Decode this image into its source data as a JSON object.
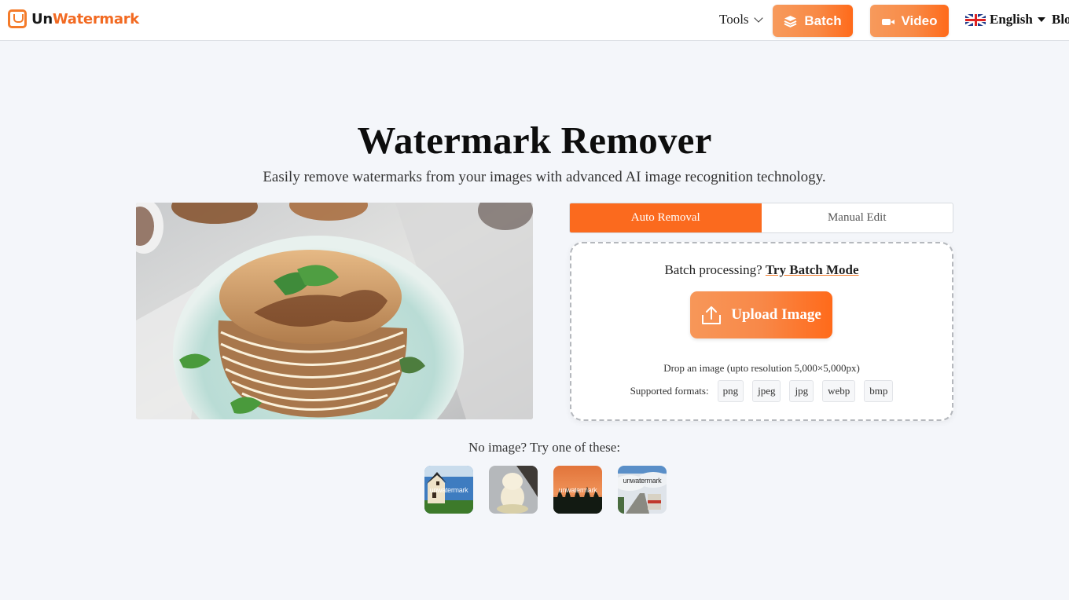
{
  "header": {
    "logo": {
      "part1": "Un",
      "part2": "Watermark"
    },
    "nav": {
      "tools_label": "Tools",
      "batch_label": "Batch",
      "video_label": "Video",
      "language_label": "English",
      "blog_label": "Blog"
    }
  },
  "hero": {
    "title": "Watermark Remover",
    "subtitle": "Easily remove watermarks from your images with advanced AI image recognition technology."
  },
  "preview": {
    "alt": "Stack of pancakes with syrup and mint on a light blue plate"
  },
  "tabs": [
    {
      "label": "Auto Removal",
      "active": true
    },
    {
      "label": "Manual Edit",
      "active": false
    }
  ],
  "upload": {
    "batch_prompt": "Batch processing?",
    "batch_link": "Try Batch Mode",
    "button_label": "Upload Image",
    "drop_text": "Drop an image (upto resolution 5,000×5,000px)",
    "formats_label": "Supported formats:",
    "formats": [
      "png",
      "jpeg",
      "jpg",
      "webp",
      "bmp"
    ]
  },
  "samples": {
    "label": "No image? Try one of these:",
    "items": [
      {
        "name": "house-by-sea",
        "watermark": "unwatermark"
      },
      {
        "name": "kitten",
        "watermark": ""
      },
      {
        "name": "sunset-silhouettes",
        "watermark": "unwatermark"
      },
      {
        "name": "bus-on-road",
        "watermark": "unwatermark"
      }
    ]
  },
  "colors": {
    "accent": "#fb6a1e",
    "accent_light": "#f79a5c",
    "background": "#f4f6fa"
  }
}
